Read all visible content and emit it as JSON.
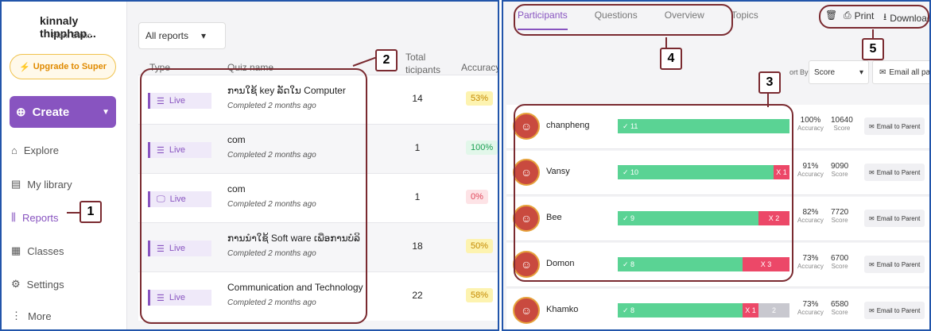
{
  "sidebar": {
    "user_name": "kinnaly thipphap...",
    "plan": "Plan: Basic",
    "upgrade_label": "Upgrade to Super",
    "create_label": "Create",
    "items": [
      {
        "label": "Explore",
        "icon": "explore-icon"
      },
      {
        "label": "My library",
        "icon": "library-icon"
      },
      {
        "label": "Reports",
        "icon": "reports-icon"
      },
      {
        "label": "Classes",
        "icon": "classes-icon"
      },
      {
        "label": "Settings",
        "icon": "settings-icon"
      },
      {
        "label": "More",
        "icon": "more-icon"
      }
    ]
  },
  "reports": {
    "filter_value": "All reports",
    "col_type": "Type",
    "col_quiz": "Quiz name",
    "col_total": "Total\nticipants",
    "col_acc": "Accuracy",
    "rows": [
      {
        "type": "Live",
        "name": "ການໃຊ້ key ລັດໃນ Computer",
        "date": "Completed 2 months ago",
        "total": "14",
        "accuracy": "53%",
        "tone": "y",
        "icon": "list-icon"
      },
      {
        "type": "Live",
        "name": "com",
        "date": "Completed 2 months ago",
        "total": "1",
        "accuracy": "100%",
        "tone": "g",
        "icon": "list-icon"
      },
      {
        "type": "Live",
        "name": "com",
        "date": "Completed 2 months ago",
        "total": "1",
        "accuracy": "0%",
        "tone": "r",
        "icon": "presentation-icon"
      },
      {
        "type": "Live",
        "name": "ການນຳໃຊ້ Soft ware ເພື່ອການບໍລິ",
        "date": "Completed 2 months ago",
        "total": "18",
        "accuracy": "50%",
        "tone": "y",
        "icon": "list-icon"
      },
      {
        "type": "Live",
        "name": "Communication and Technology",
        "date": "Completed 2 months ago",
        "total": "22",
        "accuracy": "58%",
        "tone": "y",
        "icon": "list-icon"
      }
    ]
  },
  "report_view": {
    "tabs": [
      "Participants",
      "Questions",
      "Overview",
      "Topics"
    ],
    "print_label": "Print",
    "download_label": "Download",
    "sort_label": "ort By:",
    "sort_value": "Score",
    "email_all_label": "Email all paren",
    "email_parent_label": "Email to Parent",
    "participants": [
      {
        "name": "chanpheng",
        "correct": "✓ 11",
        "wrong": "",
        "unanswered": "",
        "c": 11,
        "w": 0,
        "u": 0,
        "accuracy": "100%",
        "score": "10640"
      },
      {
        "name": "Vansy",
        "correct": "✓ 10",
        "wrong": "X 1",
        "unanswered": "",
        "c": 10,
        "w": 1,
        "u": 0,
        "accuracy": "91%",
        "score": "9090"
      },
      {
        "name": "Bee",
        "correct": "✓ 9",
        "wrong": "X 2",
        "unanswered": "",
        "c": 9,
        "w": 2,
        "u": 0,
        "accuracy": "82%",
        "score": "7720"
      },
      {
        "name": "Domon",
        "correct": "✓ 8",
        "wrong": "X 3",
        "unanswered": "",
        "c": 8,
        "w": 3,
        "u": 0,
        "accuracy": "73%",
        "score": "6700"
      },
      {
        "name": "Khamko",
        "correct": "✓ 8",
        "wrong": "X 1",
        "unanswered": "2",
        "c": 8,
        "w": 1,
        "u": 2,
        "accuracy": "73%",
        "score": "6580"
      }
    ],
    "acc_label": "Accuracy",
    "score_label": "Score"
  },
  "callouts": [
    "1",
    "2",
    "3",
    "4",
    "5"
  ],
  "colors": {
    "accent": "#8854c0",
    "callout": "#7a2a30",
    "correct": "#5ad394",
    "wrong": "#ec4868"
  }
}
